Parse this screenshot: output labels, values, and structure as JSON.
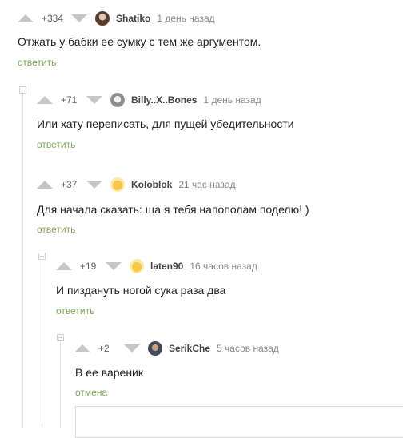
{
  "comments": [
    {
      "rating": "+334",
      "user": "Shatiko",
      "time": "1 день назад",
      "text": "Отжать у бабки ее сумку с тем же аргументом.",
      "action": "ответить"
    },
    {
      "rating": "+71",
      "user": "Billy..X..Bones",
      "time": "1 день назад",
      "text": "Или хату переписать, для пущей убедительности",
      "action": "ответить"
    },
    {
      "rating": "+37",
      "user": "Koloblok",
      "time": "21 час назад",
      "text": "Для начала сказать: ща я тебя напополам поделю! )",
      "action": "ответить"
    },
    {
      "rating": "+19",
      "user": "laten90",
      "time": "16 часов назад",
      "text": "И пиздануть ногой сука раза два",
      "action": "ответить"
    },
    {
      "rating": "+2",
      "user": "SerikChe",
      "time": "5 часов назад",
      "text": "В ее вареник",
      "action": "отмена"
    }
  ],
  "icons": {
    "vote_up": "arrow-up-icon",
    "vote_down": "arrow-down-icon",
    "collapse": "collapse-icon"
  },
  "colors": {
    "action_link": "#7da65a",
    "arrow": "#c6c6c6"
  }
}
